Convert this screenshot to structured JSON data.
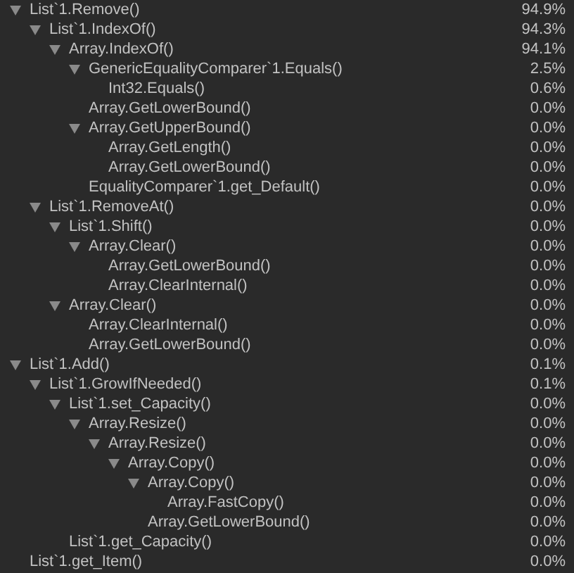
{
  "tree": [
    {
      "label": "List`1.Remove()",
      "value": "94.9%",
      "expanded": true,
      "children": [
        {
          "label": "List`1.IndexOf()",
          "value": "94.3%",
          "expanded": true,
          "children": [
            {
              "label": "Array.IndexOf()",
              "value": "94.1%",
              "expanded": true,
              "children": [
                {
                  "label": "GenericEqualityComparer`1.Equals()",
                  "value": "2.5%",
                  "expanded": true,
                  "children": [
                    {
                      "label": "Int32.Equals()",
                      "value": "0.6%"
                    }
                  ]
                },
                {
                  "label": "Array.GetLowerBound()",
                  "value": "0.0%"
                },
                {
                  "label": "Array.GetUpperBound()",
                  "value": "0.0%",
                  "expanded": true,
                  "children": [
                    {
                      "label": "Array.GetLength()",
                      "value": "0.0%"
                    },
                    {
                      "label": "Array.GetLowerBound()",
                      "value": "0.0%"
                    }
                  ]
                },
                {
                  "label": "EqualityComparer`1.get_Default()",
                  "value": "0.0%"
                }
              ]
            }
          ]
        },
        {
          "label": "List`1.RemoveAt()",
          "value": "0.0%",
          "expanded": true,
          "children": [
            {
              "label": "List`1.Shift()",
              "value": "0.0%",
              "expanded": true,
              "children": [
                {
                  "label": "Array.Clear()",
                  "value": "0.0%",
                  "expanded": true,
                  "children": [
                    {
                      "label": "Array.GetLowerBound()",
                      "value": "0.0%"
                    },
                    {
                      "label": "Array.ClearInternal()",
                      "value": "0.0%"
                    }
                  ]
                }
              ]
            },
            {
              "label": "Array.Clear()",
              "value": "0.0%",
              "expanded": true,
              "children": [
                {
                  "label": "Array.ClearInternal()",
                  "value": "0.0%"
                },
                {
                  "label": "Array.GetLowerBound()",
                  "value": "0.0%"
                }
              ]
            }
          ]
        }
      ]
    },
    {
      "label": "List`1.Add()",
      "value": "0.1%",
      "expanded": true,
      "children": [
        {
          "label": "List`1.GrowIfNeeded()",
          "value": "0.1%",
          "expanded": true,
          "children": [
            {
              "label": "List`1.set_Capacity()",
              "value": "0.0%",
              "expanded": true,
              "children": [
                {
                  "label": "Array.Resize()",
                  "value": "0.0%",
                  "expanded": true,
                  "children": [
                    {
                      "label": "Array.Resize()",
                      "value": "0.0%",
                      "expanded": true,
                      "children": [
                        {
                          "label": "Array.Copy()",
                          "value": "0.0%",
                          "expanded": true,
                          "children": [
                            {
                              "label": "Array.Copy()",
                              "value": "0.0%",
                              "expanded": true,
                              "children": [
                                {
                                  "label": "Array.FastCopy()",
                                  "value": "0.0%"
                                }
                              ]
                            },
                            {
                              "label": "Array.GetLowerBound()",
                              "value": "0.0%"
                            }
                          ]
                        }
                      ]
                    }
                  ]
                }
              ]
            },
            {
              "label": "List`1.get_Capacity()",
              "value": "0.0%"
            }
          ]
        }
      ]
    },
    {
      "label": "List`1.get_Item()",
      "value": "0.0%"
    }
  ]
}
